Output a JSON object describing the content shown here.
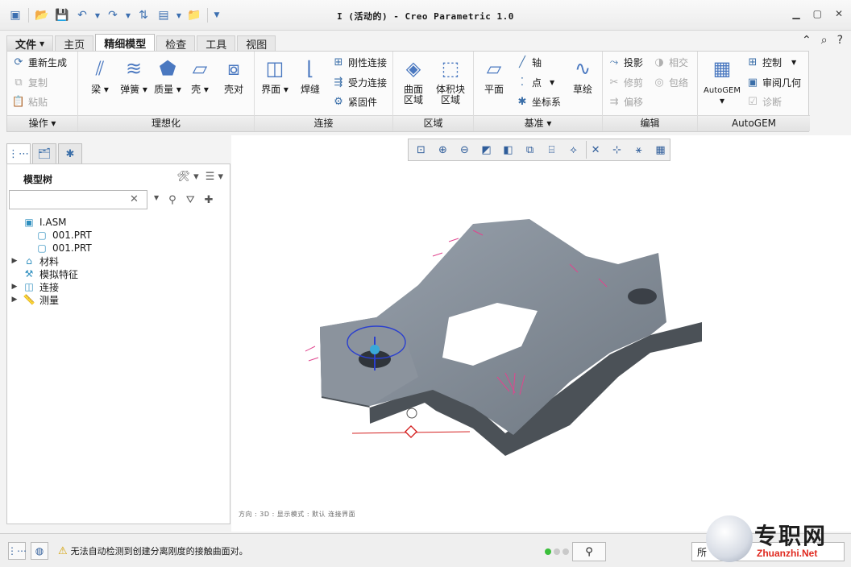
{
  "window": {
    "title": "I (活动的) - Creo Parametric 1.0"
  },
  "ribbon": {
    "tabs": [
      "文件",
      "主页",
      "精细模型",
      "检查",
      "工具",
      "视图"
    ],
    "active_tab": "精细模型",
    "groups": {
      "operations": {
        "label": "操作",
        "items": [
          "重新生成",
          "复制",
          "粘贴"
        ]
      },
      "idealization": {
        "label": "理想化",
        "items": [
          "梁",
          "弹簧",
          "质量",
          "壳",
          "壳对"
        ]
      },
      "connection": {
        "label": "连接",
        "big": [
          "界面",
          "焊缝"
        ],
        "small": [
          "刚性连接",
          "受力连接",
          "紧固件"
        ]
      },
      "region": {
        "label": "区域",
        "items": [
          "曲面\n区域",
          "体积块\n区域"
        ]
      },
      "datum": {
        "label": "基准",
        "big": [
          "平面",
          "草绘"
        ],
        "small": [
          "轴",
          "点",
          "坐标系"
        ]
      },
      "edit": {
        "label": "编辑",
        "items": [
          "投影",
          "修剪",
          "偏移",
          "相交",
          "包络"
        ]
      },
      "autogem": {
        "label": "AutoGEM",
        "big": "AutoGEM",
        "small": [
          "控制",
          "审阅几何",
          "诊断"
        ]
      }
    }
  },
  "model_tree": {
    "title": "模型树",
    "search_value": "",
    "items": [
      {
        "label": "I.ASM",
        "expand": ""
      },
      {
        "label": "001.PRT",
        "expand": ""
      },
      {
        "label": "001.PRT",
        "expand": ""
      },
      {
        "label": "材料",
        "expand": "▶"
      },
      {
        "label": "模拟特征",
        "expand": ""
      },
      {
        "label": "连接",
        "expand": "▶"
      },
      {
        "label": "测量",
        "expand": "▶"
      }
    ]
  },
  "graphics": {
    "caption": "方向 : 3D : 显示模式 : 默认 连接界面"
  },
  "status": {
    "message": "无法自动检测到创建分离刚度的接触曲面对。",
    "selection_filter": "所"
  },
  "watermark": {
    "cn": "专职网",
    "en": "Zhuanzhi.Net"
  }
}
